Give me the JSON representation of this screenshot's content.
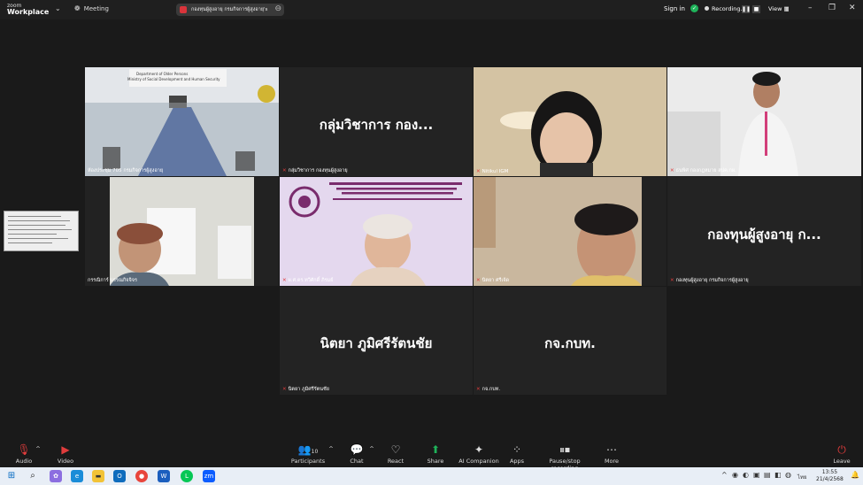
{
  "app": {
    "brand_small": "zoom",
    "brand": "Workplace",
    "meeting_label": "Meeting"
  },
  "share": {
    "title": "กองทุนผู้สูงอายุ กรมกิจการผู้สูงอายุ's sc"
  },
  "header_right": {
    "sign_in": "Sign in",
    "recording": "Recording...",
    "view": "View"
  },
  "participants_tiles": [
    {
      "label": "ห้องประชุม 705 กรมกิจการผู้สูงอายุ",
      "big": ""
    },
    {
      "label": "กลุ่มวิชาการ กองทุนผู้สูงอายุ",
      "big": "กลุ่มวิชาการ กอง..."
    },
    {
      "label": "Nitikul IGM",
      "big": ""
    },
    {
      "label": "ธนพิศ กองกฎหมาย สปค.กผ.",
      "big": ""
    },
    {
      "label": "กรรณิการ์ บรรณกิจจิจร",
      "big": ""
    },
    {
      "label": "ผ.ศ.ดร.ทวีศักดิ์ ภิรมย์",
      "big": ""
    },
    {
      "label": "นิตยา ศรีเจ้ด",
      "big": ""
    },
    {
      "label": "กองทุนผู้สูงอายุ กรมกิจการผู้สูงอายุ",
      "big": "กองทุนผู้สูงอายุ ก..."
    },
    {
      "label": "นิตยา ภูมิศรีรัตนชัย",
      "big": "นิตยา ภูมิศรีรัตนชัย"
    },
    {
      "label": "กจ.กบท.",
      "big": "กจ.กบท."
    }
  ],
  "room_slide": {
    "line1": "Department of Older Persons",
    "line2": "Ministry of Social Development and Human Security"
  },
  "toolbar": {
    "audio": "Audio",
    "video": "Video",
    "participants": "Participants",
    "participants_count": "10",
    "chat": "Chat",
    "react": "React",
    "share": "Share",
    "ai": "AI Companion",
    "apps": "Apps",
    "record": "Pause/stop recording",
    "more": "More",
    "leave": "Leave"
  },
  "taskbar": {
    "lang": "ไทย",
    "time": "13:55",
    "date": "21/4/2568"
  },
  "colors": {
    "active_border": "#24c66a",
    "share_green": "#1fb35a",
    "muted_red": "#e03c3c"
  }
}
